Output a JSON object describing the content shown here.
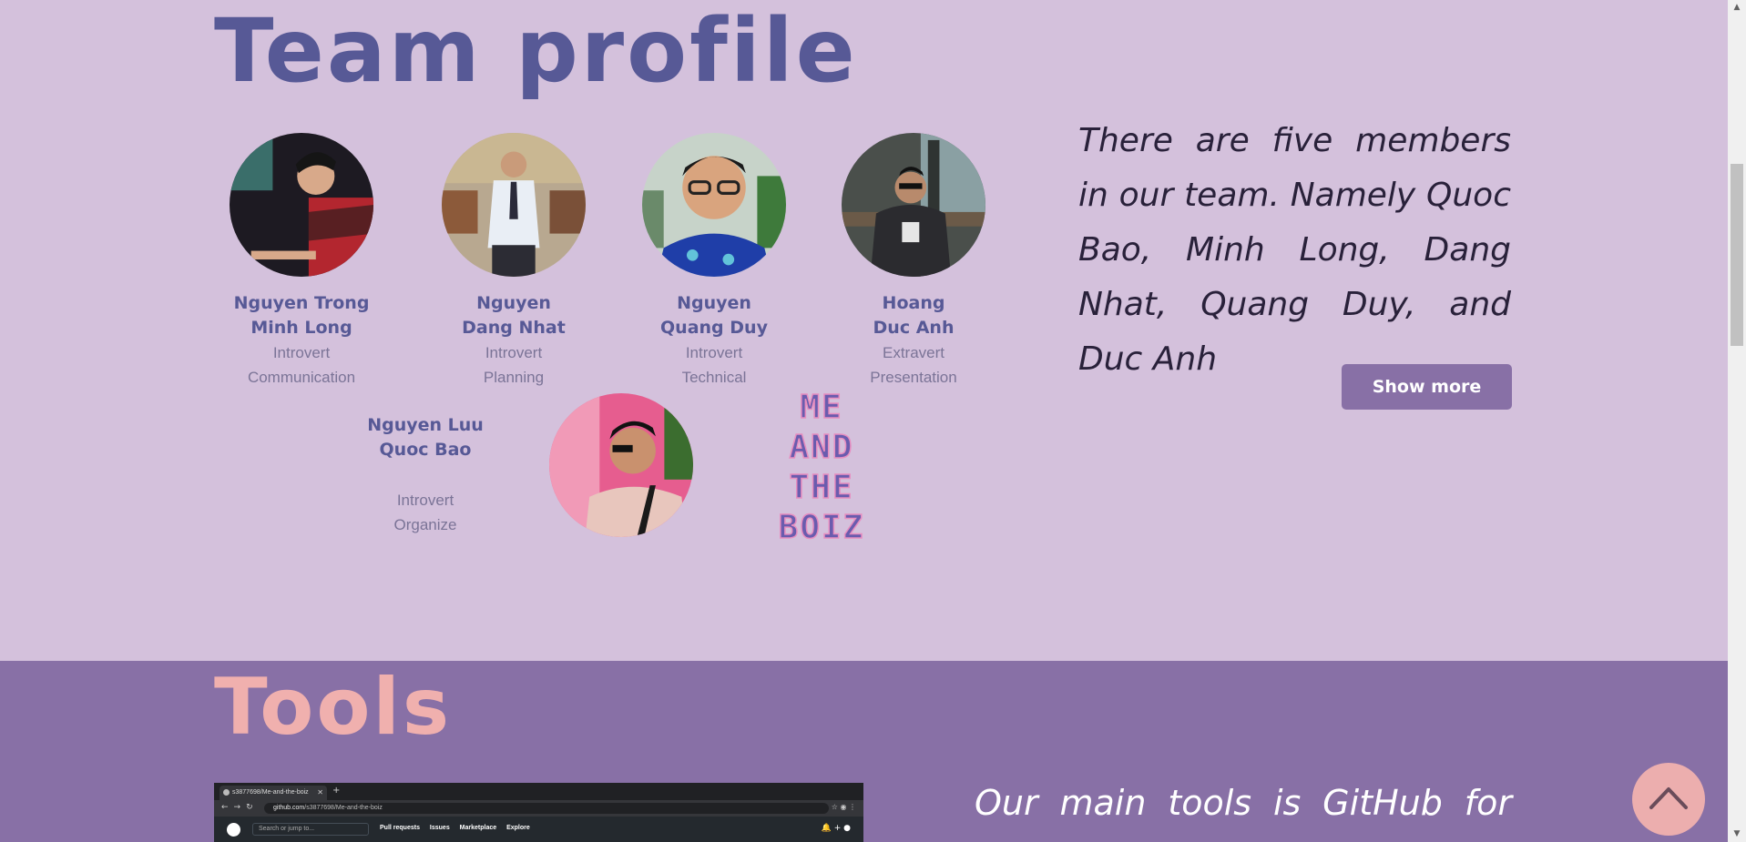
{
  "team": {
    "title": "Team profile",
    "members": [
      {
        "name_line1": "Nguyen Trong",
        "name_line2": "Minh Long",
        "trait1": "Introvert",
        "trait2": "Communication"
      },
      {
        "name_line1": "Nguyen",
        "name_line2": "Dang Nhat",
        "trait1": "Introvert",
        "trait2": "Planning"
      },
      {
        "name_line1": "Nguyen",
        "name_line2": "Quang Duy",
        "trait1": "Introvert",
        "trait2": "Technical"
      },
      {
        "name_line1": "Hoang",
        "name_line2": "Duc Anh",
        "trait1": "Extravert",
        "trait2": "Presentation"
      },
      {
        "name_line1": "Nguyen Luu",
        "name_line2": "Quoc Bao",
        "trait1": "Introvert",
        "trait2": "Organize"
      }
    ],
    "logo_lines": [
      "ME",
      "AND",
      "THE",
      "BOIZ"
    ],
    "description": "There are five members in our team. Namely Quoc Bao, Minh Long, Dang Nhat, Quang Duy, and Duc Anh",
    "show_more_label": "Show more"
  },
  "tools": {
    "title": "Tools",
    "description": "Our main tools is GitHub for",
    "screenshot": {
      "tab_title": "s3877698/Me-and-the-boiz",
      "url_host": "github.com",
      "url_path": "/s3877698/Me-and-the-boiz",
      "search_placeholder": "Search or jump to...",
      "nav_links": [
        "Pull requests",
        "Issues",
        "Marketplace",
        "Explore"
      ]
    }
  },
  "colors": {
    "team_bg": "#d4c1dc",
    "tools_bg": "#8870a6",
    "title_team": "#575996",
    "title_tools": "#f0b0ae",
    "button": "#8870a6",
    "back_to_top": "#ecaeae"
  },
  "icons": {
    "back_to_top": "chevron-up-icon"
  }
}
